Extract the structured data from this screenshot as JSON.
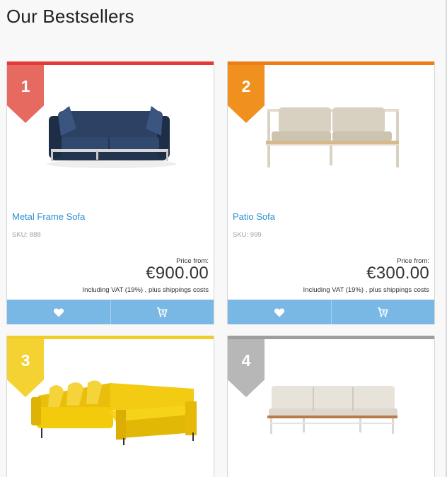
{
  "page": {
    "title": "Our Bestsellers"
  },
  "products": [
    {
      "rank": "1",
      "name": "Metal Frame Sofa",
      "sku": "SKU: 888",
      "price_from": "Price from:",
      "price": "€900.00",
      "vat_note": "Including VAT (19%) , plus shippings costs",
      "accent": "#e53935",
      "ribbon_color": "#e66a60"
    },
    {
      "rank": "2",
      "name": "Patio Sofa",
      "sku": "SKU: 999",
      "price_from": "Price from:",
      "price": "€300.00",
      "vat_note": "Including VAT (19%) , plus shippings costs",
      "accent": "#ef7d16",
      "ribbon_color": "#f0901f"
    },
    {
      "rank": "3",
      "accent": "#f2cd2a",
      "ribbon_color": "#f3d232"
    },
    {
      "rank": "4",
      "accent": "#9e9e9e",
      "ribbon_color": "#b7b7b7"
    }
  ],
  "icons": {
    "wishlist": "heart-icon",
    "cart": "cart-icon"
  }
}
